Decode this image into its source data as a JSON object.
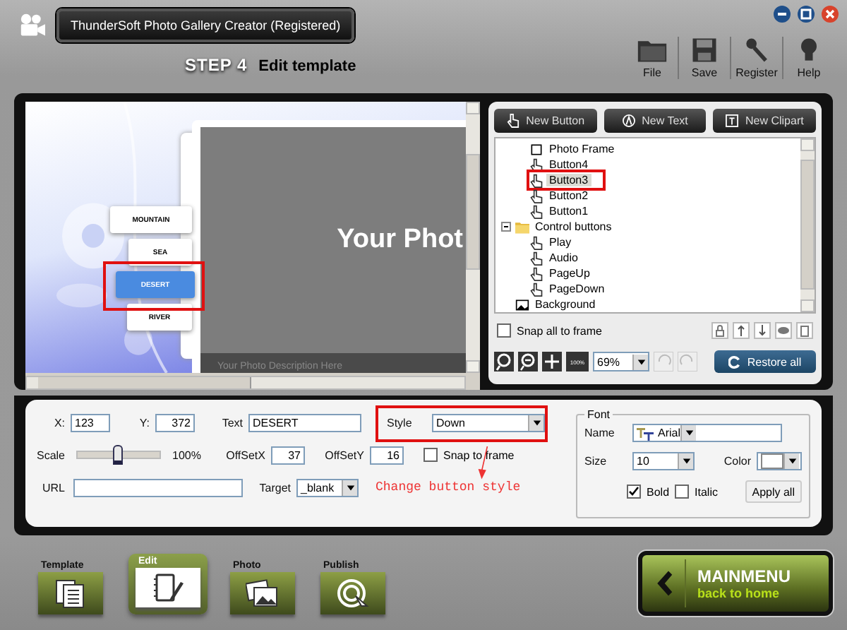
{
  "window": {
    "title": "ThunderSoft Photo Gallery Creator (Registered)"
  },
  "toolbar": [
    {
      "label": "File",
      "kind": "folder"
    },
    {
      "label": "Save",
      "kind": "save"
    },
    {
      "label": "Register",
      "kind": "key"
    },
    {
      "label": "Help",
      "kind": "bulb"
    }
  ],
  "step": {
    "number": "STEP 4",
    "title": "Edit template"
  },
  "preview": {
    "menu": [
      {
        "label": "MOUNTAIN",
        "selected": false
      },
      {
        "label": "SEA",
        "selected": false
      },
      {
        "label": "DESERT",
        "selected": true
      },
      {
        "label": "RIVER",
        "selected": false
      }
    ],
    "headline": "Your Phot",
    "caption": "Your Photo Description Here"
  },
  "object_buttons": [
    {
      "label": "New Button",
      "kind": "hand"
    },
    {
      "label": "New Text",
      "kind": "text"
    },
    {
      "label": "New Clipart",
      "kind": "clipart"
    }
  ],
  "tree": [
    {
      "children": [
        {
          "label": "Photo Frame",
          "kind": "frame",
          "selected": false
        },
        {
          "label": "Button4",
          "kind": "hand",
          "selected": false
        },
        {
          "label": "Button3",
          "kind": "hand",
          "selected": true
        },
        {
          "label": "Button2",
          "kind": "hand",
          "selected": false
        },
        {
          "label": "Button1",
          "kind": "hand",
          "selected": false
        }
      ]
    },
    {
      "label": "Control buttons",
      "kind": "folder",
      "selected": false,
      "expanded": true,
      "children": [
        {
          "label": "Play",
          "kind": "hand",
          "selected": false
        },
        {
          "label": "Audio",
          "kind": "hand",
          "selected": false
        },
        {
          "label": "PageUp",
          "kind": "hand",
          "selected": false
        },
        {
          "label": "PageDown",
          "kind": "hand",
          "selected": false
        }
      ]
    },
    {
      "label": "Background",
      "kind": "image",
      "selected": false
    }
  ],
  "snap_all": {
    "label": "Snap all to frame",
    "checked": false
  },
  "zoom": {
    "value": "69%",
    "fit_label": "100%"
  },
  "restore_button": "Restore all",
  "properties": {
    "x": {
      "label": "X:",
      "value": "123"
    },
    "y": {
      "label": "Y:",
      "value": "372"
    },
    "text": {
      "label": "Text",
      "value": "DESERT"
    },
    "style": {
      "label": "Style",
      "value": "Down"
    },
    "scale": {
      "label": "Scale",
      "level": 0.5,
      "reading": "100%"
    },
    "offset_x": {
      "label": "OffSetX",
      "value": "37"
    },
    "offset_y": {
      "label": "OffSetY",
      "value": "16"
    },
    "snap": {
      "label": "Snap to frame",
      "checked": false
    },
    "url": {
      "label": "URL"
    },
    "target": {
      "label": "Target",
      "value": "_blank"
    }
  },
  "font": {
    "title": "Font",
    "name_label": "Name",
    "name": "Arial",
    "size_label": "Size",
    "size": "10",
    "color_label": "Color",
    "bold": {
      "label": "Bold",
      "checked": true
    },
    "italic": {
      "label": "Italic",
      "checked": false
    },
    "apply_button": "Apply all"
  },
  "annotation": "Change button style",
  "nav_tabs": [
    {
      "label": "Template",
      "kind": "template",
      "selected": false
    },
    {
      "label": "Edit",
      "kind": "edit",
      "selected": true
    },
    {
      "label": "Photo",
      "kind": "photo",
      "selected": false
    },
    {
      "label": "Publish",
      "kind": "publish",
      "selected": false
    }
  ],
  "main_menu": {
    "title": "MAINMENU",
    "subtitle": "back to home"
  }
}
